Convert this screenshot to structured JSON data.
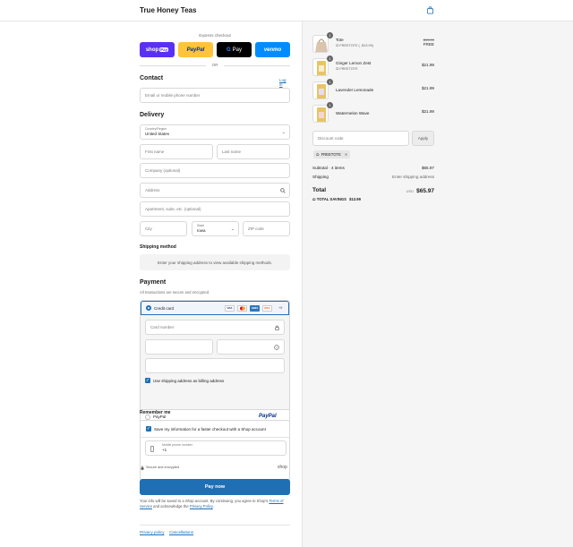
{
  "header": {
    "brand": "True Honey Teas",
    "cart_icon": "shopping-bag-icon"
  },
  "express": {
    "label": "Express checkout",
    "buttons": [
      {
        "label": "shop Pay",
        "bg": "#5a31f4",
        "fg": "#ffffff"
      },
      {
        "label": "PayPal",
        "bg": "#ffc439",
        "fg": "#003087"
      },
      {
        "label": "G Pay",
        "bg": "#000000",
        "fg": "#ffffff"
      },
      {
        "label": "venmo",
        "bg": "#008cff",
        "fg": "#ffffff"
      }
    ],
    "or": "OR"
  },
  "contact": {
    "title": "Contact",
    "login": "Log in",
    "email_placeholder": "Email or mobile phone number"
  },
  "delivery": {
    "title": "Delivery",
    "country_label": "Country/Region",
    "country_value": "United States",
    "first_name": "First name",
    "last_name": "Last name",
    "company": "Company (optional)",
    "address": "Address",
    "apartment": "Apartment, suite, etc. (optional)",
    "city": "City",
    "state_label": "State",
    "state_value": "Iowa",
    "zip": "ZIP code"
  },
  "shipping": {
    "title": "Shipping method",
    "message": "Enter your shipping address to view available shipping methods."
  },
  "payment": {
    "title": "Payment",
    "subtitle": "All transactions are secure and encrypted.",
    "credit_card_label": "Credit card",
    "card_logos": [
      "VISA",
      "MC",
      "AMEX",
      "DISC"
    ],
    "more_cards": "+5",
    "card_number_placeholder": "Card number",
    "billing_checkbox": "Use shipping address as billing address",
    "paypal_label": "PayPal",
    "paypal_logo": "PayPal"
  },
  "remember": {
    "title": "Remember me",
    "save_label": "Save my information for a faster checkout with a Shop account",
    "phone_label": "Mobile phone number",
    "phone_value": "+1",
    "secure_text": "Secure and encrypted",
    "shop_logo": "shop"
  },
  "pay_now": "Pay now",
  "legal": {
    "text1": "Your info will be saved to a Shop account. By continuing, you agree to Shop's",
    "terms": "Terms of Service",
    "text2": "and acknowledge the",
    "privacy": "Privacy Policy",
    "text3": "."
  },
  "footer": {
    "privacy_policy": "Privacy policy",
    "cancellations": "Cancellations"
  },
  "cart": {
    "items": [
      {
        "name": "Tote",
        "discount": "FREETOTE ( -$13.99)",
        "old_price": "$13.99",
        "price": "FREE",
        "qty": "1"
      },
      {
        "name": "Ginger Lemon Zest",
        "discount": "FREETOTE",
        "price": "$21.99",
        "qty": "1"
      },
      {
        "name": "Lavender Lemonade",
        "price": "$21.99",
        "qty": "1"
      },
      {
        "name": "Watermelon Wave",
        "price": "$21.99",
        "qty": "1"
      }
    ],
    "discount_placeholder": "Discount code",
    "apply": "Apply",
    "applied_code": "FREETOTE",
    "subtotal_label": "Subtotal · 4 items",
    "subtotal_value": "$65.97",
    "shipping_label": "Shipping",
    "shipping_value": "Enter shipping address",
    "total_label": "Total",
    "currency": "USD",
    "total_value": "$65.97",
    "savings_label": "TOTAL SAVINGS",
    "savings_value": "$13.99"
  }
}
